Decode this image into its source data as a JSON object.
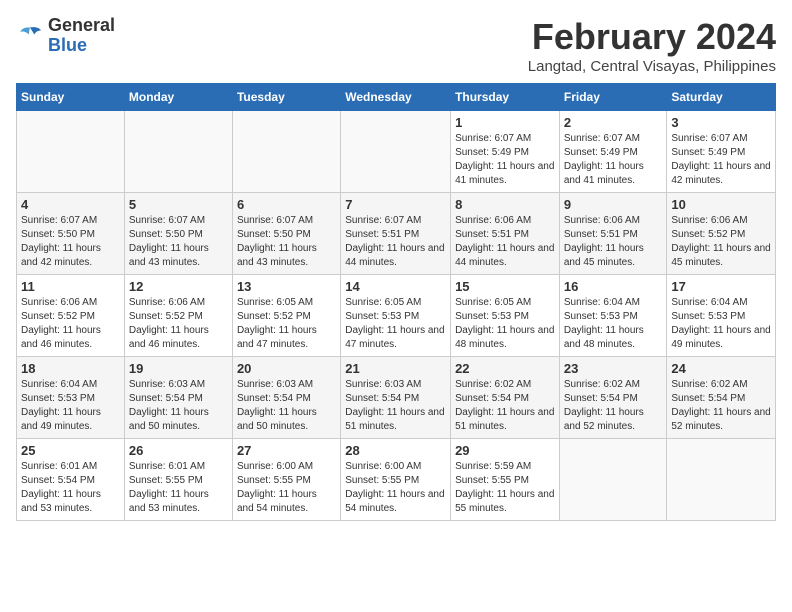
{
  "logo": {
    "general": "General",
    "blue": "Blue"
  },
  "title": "February 2024",
  "location": "Langtad, Central Visayas, Philippines",
  "days_of_week": [
    "Sunday",
    "Monday",
    "Tuesday",
    "Wednesday",
    "Thursday",
    "Friday",
    "Saturday"
  ],
  "weeks": [
    [
      {
        "day": "",
        "sunrise": "",
        "sunset": "",
        "daylight": ""
      },
      {
        "day": "",
        "sunrise": "",
        "sunset": "",
        "daylight": ""
      },
      {
        "day": "",
        "sunrise": "",
        "sunset": "",
        "daylight": ""
      },
      {
        "day": "",
        "sunrise": "",
        "sunset": "",
        "daylight": ""
      },
      {
        "day": "1",
        "sunrise": "Sunrise: 6:07 AM",
        "sunset": "Sunset: 5:49 PM",
        "daylight": "Daylight: 11 hours and 41 minutes."
      },
      {
        "day": "2",
        "sunrise": "Sunrise: 6:07 AM",
        "sunset": "Sunset: 5:49 PM",
        "daylight": "Daylight: 11 hours and 41 minutes."
      },
      {
        "day": "3",
        "sunrise": "Sunrise: 6:07 AM",
        "sunset": "Sunset: 5:49 PM",
        "daylight": "Daylight: 11 hours and 42 minutes."
      }
    ],
    [
      {
        "day": "4",
        "sunrise": "Sunrise: 6:07 AM",
        "sunset": "Sunset: 5:50 PM",
        "daylight": "Daylight: 11 hours and 42 minutes."
      },
      {
        "day": "5",
        "sunrise": "Sunrise: 6:07 AM",
        "sunset": "Sunset: 5:50 PM",
        "daylight": "Daylight: 11 hours and 43 minutes."
      },
      {
        "day": "6",
        "sunrise": "Sunrise: 6:07 AM",
        "sunset": "Sunset: 5:50 PM",
        "daylight": "Daylight: 11 hours and 43 minutes."
      },
      {
        "day": "7",
        "sunrise": "Sunrise: 6:07 AM",
        "sunset": "Sunset: 5:51 PM",
        "daylight": "Daylight: 11 hours and 44 minutes."
      },
      {
        "day": "8",
        "sunrise": "Sunrise: 6:06 AM",
        "sunset": "Sunset: 5:51 PM",
        "daylight": "Daylight: 11 hours and 44 minutes."
      },
      {
        "day": "9",
        "sunrise": "Sunrise: 6:06 AM",
        "sunset": "Sunset: 5:51 PM",
        "daylight": "Daylight: 11 hours and 45 minutes."
      },
      {
        "day": "10",
        "sunrise": "Sunrise: 6:06 AM",
        "sunset": "Sunset: 5:52 PM",
        "daylight": "Daylight: 11 hours and 45 minutes."
      }
    ],
    [
      {
        "day": "11",
        "sunrise": "Sunrise: 6:06 AM",
        "sunset": "Sunset: 5:52 PM",
        "daylight": "Daylight: 11 hours and 46 minutes."
      },
      {
        "day": "12",
        "sunrise": "Sunrise: 6:06 AM",
        "sunset": "Sunset: 5:52 PM",
        "daylight": "Daylight: 11 hours and 46 minutes."
      },
      {
        "day": "13",
        "sunrise": "Sunrise: 6:05 AM",
        "sunset": "Sunset: 5:52 PM",
        "daylight": "Daylight: 11 hours and 47 minutes."
      },
      {
        "day": "14",
        "sunrise": "Sunrise: 6:05 AM",
        "sunset": "Sunset: 5:53 PM",
        "daylight": "Daylight: 11 hours and 47 minutes."
      },
      {
        "day": "15",
        "sunrise": "Sunrise: 6:05 AM",
        "sunset": "Sunset: 5:53 PM",
        "daylight": "Daylight: 11 hours and 48 minutes."
      },
      {
        "day": "16",
        "sunrise": "Sunrise: 6:04 AM",
        "sunset": "Sunset: 5:53 PM",
        "daylight": "Daylight: 11 hours and 48 minutes."
      },
      {
        "day": "17",
        "sunrise": "Sunrise: 6:04 AM",
        "sunset": "Sunset: 5:53 PM",
        "daylight": "Daylight: 11 hours and 49 minutes."
      }
    ],
    [
      {
        "day": "18",
        "sunrise": "Sunrise: 6:04 AM",
        "sunset": "Sunset: 5:53 PM",
        "daylight": "Daylight: 11 hours and 49 minutes."
      },
      {
        "day": "19",
        "sunrise": "Sunrise: 6:03 AM",
        "sunset": "Sunset: 5:54 PM",
        "daylight": "Daylight: 11 hours and 50 minutes."
      },
      {
        "day": "20",
        "sunrise": "Sunrise: 6:03 AM",
        "sunset": "Sunset: 5:54 PM",
        "daylight": "Daylight: 11 hours and 50 minutes."
      },
      {
        "day": "21",
        "sunrise": "Sunrise: 6:03 AM",
        "sunset": "Sunset: 5:54 PM",
        "daylight": "Daylight: 11 hours and 51 minutes."
      },
      {
        "day": "22",
        "sunrise": "Sunrise: 6:02 AM",
        "sunset": "Sunset: 5:54 PM",
        "daylight": "Daylight: 11 hours and 51 minutes."
      },
      {
        "day": "23",
        "sunrise": "Sunrise: 6:02 AM",
        "sunset": "Sunset: 5:54 PM",
        "daylight": "Daylight: 11 hours and 52 minutes."
      },
      {
        "day": "24",
        "sunrise": "Sunrise: 6:02 AM",
        "sunset": "Sunset: 5:54 PM",
        "daylight": "Daylight: 11 hours and 52 minutes."
      }
    ],
    [
      {
        "day": "25",
        "sunrise": "Sunrise: 6:01 AM",
        "sunset": "Sunset: 5:54 PM",
        "daylight": "Daylight: 11 hours and 53 minutes."
      },
      {
        "day": "26",
        "sunrise": "Sunrise: 6:01 AM",
        "sunset": "Sunset: 5:55 PM",
        "daylight": "Daylight: 11 hours and 53 minutes."
      },
      {
        "day": "27",
        "sunrise": "Sunrise: 6:00 AM",
        "sunset": "Sunset: 5:55 PM",
        "daylight": "Daylight: 11 hours and 54 minutes."
      },
      {
        "day": "28",
        "sunrise": "Sunrise: 6:00 AM",
        "sunset": "Sunset: 5:55 PM",
        "daylight": "Daylight: 11 hours and 54 minutes."
      },
      {
        "day": "29",
        "sunrise": "Sunrise: 5:59 AM",
        "sunset": "Sunset: 5:55 PM",
        "daylight": "Daylight: 11 hours and 55 minutes."
      },
      {
        "day": "",
        "sunrise": "",
        "sunset": "",
        "daylight": ""
      },
      {
        "day": "",
        "sunrise": "",
        "sunset": "",
        "daylight": ""
      }
    ]
  ]
}
